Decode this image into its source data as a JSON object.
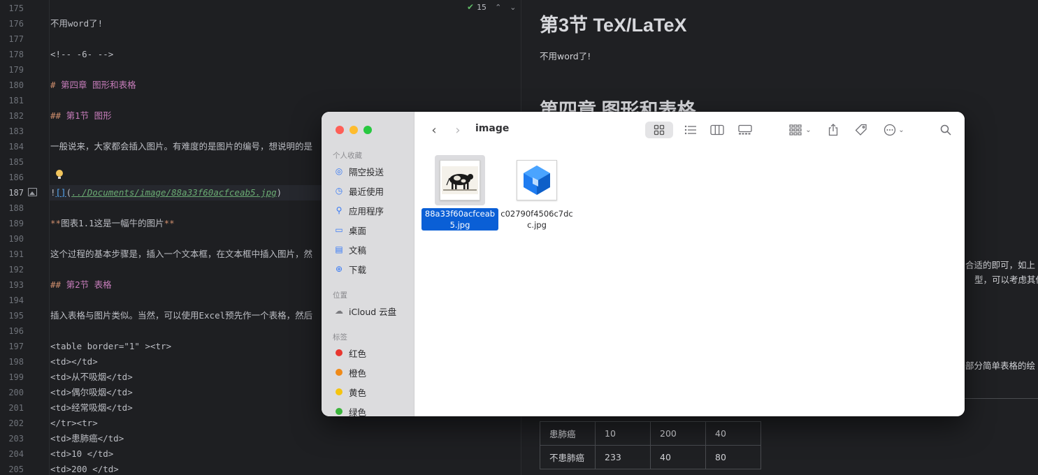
{
  "editor": {
    "inspection_count": "15",
    "lines": [
      {
        "n": "175",
        "t": ""
      },
      {
        "n": "176",
        "t": "不用word了!"
      },
      {
        "n": "177",
        "t": ""
      },
      {
        "n": "178",
        "t": "<!-- -6- -->"
      },
      {
        "n": "179",
        "t": ""
      },
      {
        "n": "180",
        "hash": "#",
        "t": " 第四章 图形和表格"
      },
      {
        "n": "181",
        "t": ""
      },
      {
        "n": "182",
        "hash": "##",
        "t": " 第1节 图形"
      },
      {
        "n": "183",
        "t": ""
      },
      {
        "n": "184",
        "t": "一般说来，大家都会插入图片。有难度的是图片的编号，想说明的是"
      },
      {
        "n": "185",
        "t": ""
      },
      {
        "n": "186",
        "t": ""
      },
      {
        "n": "187",
        "t": ""
      },
      {
        "n": "188",
        "t": ""
      },
      {
        "n": "189",
        "t": ""
      },
      {
        "n": "190",
        "t": ""
      },
      {
        "n": "191",
        "t": "这个过程的基本步骤是，插入一个文本框，在文本框中插入图片，然"
      },
      {
        "n": "192",
        "t": ""
      },
      {
        "n": "193",
        "hash": "##",
        "t": " 第2节 表格"
      },
      {
        "n": "194",
        "t": ""
      },
      {
        "n": "195",
        "t": "插入表格与图片类似。当然，可以使用Excel预先作一个表格，然后"
      },
      {
        "n": "196",
        "t": ""
      },
      {
        "n": "197",
        "t": "<table border=\"1\" ><tr>"
      },
      {
        "n": "198",
        "t": "<td></td>"
      },
      {
        "n": "199",
        "t": "<td>从不吸烟</td>"
      },
      {
        "n": "200",
        "t": "<td>偶尔吸烟</td>"
      },
      {
        "n": "201",
        "t": "<td>经常吸烟</td>"
      },
      {
        "n": "202",
        "t": "</tr><tr>"
      },
      {
        "n": "203",
        "t": "<td>患肺癌</td>"
      },
      {
        "n": "204",
        "t": "<td>10 </td>"
      },
      {
        "n": "205",
        "t": "<td>200 </td>"
      }
    ],
    "image_line": {
      "bang": "!",
      "brackets": "[]",
      "open": "(",
      "url": "../Documents/image/88a33f60acfceab5.jpg",
      "close": ")"
    },
    "bold_line": {
      "stars": "**",
      "text": "图表1.1这是一幅牛的图片"
    }
  },
  "preview": {
    "heading2": "第3节 TeX/LaTeX",
    "para1": "不用word了!",
    "heading1": "第四章 图形和表格",
    "frag1": "合适的即可，如上",
    "frag2": "型，可以考虑其他",
    "frag3": "部分简单表格的绘",
    "table_rows": [
      [
        "患肺癌",
        "10",
        "200",
        "40"
      ],
      [
        "不患肺癌",
        "233",
        "40",
        "80"
      ]
    ]
  },
  "finder": {
    "title": "image",
    "sidebar": {
      "favorites_label": "个人收藏",
      "favorites": [
        {
          "label": "隔空投送",
          "icon": "airdrop-icon",
          "glyph": "◎"
        },
        {
          "label": "最近使用",
          "icon": "clock-icon",
          "glyph": "◷"
        },
        {
          "label": "应用程序",
          "icon": "applications-icon",
          "glyph": "⚲"
        },
        {
          "label": "桌面",
          "icon": "desktop-icon",
          "glyph": "▭"
        },
        {
          "label": "文稿",
          "icon": "document-icon",
          "glyph": "▤"
        },
        {
          "label": "下载",
          "icon": "download-icon",
          "glyph": "⊕"
        }
      ],
      "locations_label": "位置",
      "locations": [
        {
          "label": "iCloud 云盘",
          "icon": "cloud-icon",
          "glyph": "☁"
        }
      ],
      "tags_label": "标签",
      "tags": [
        {
          "label": "红色",
          "color": "#e8372f"
        },
        {
          "label": "橙色",
          "color": "#ef8a18"
        },
        {
          "label": "黄色",
          "color": "#f5c40f"
        },
        {
          "label": "绿色",
          "color": "#3bb43b"
        }
      ]
    },
    "files": [
      {
        "name": "88a33f60acfceab5.jpg",
        "selected": true,
        "kind": "cow"
      },
      {
        "name": "c02790f4506c7dcc.jpg",
        "selected": false,
        "kind": "cube"
      }
    ]
  }
}
